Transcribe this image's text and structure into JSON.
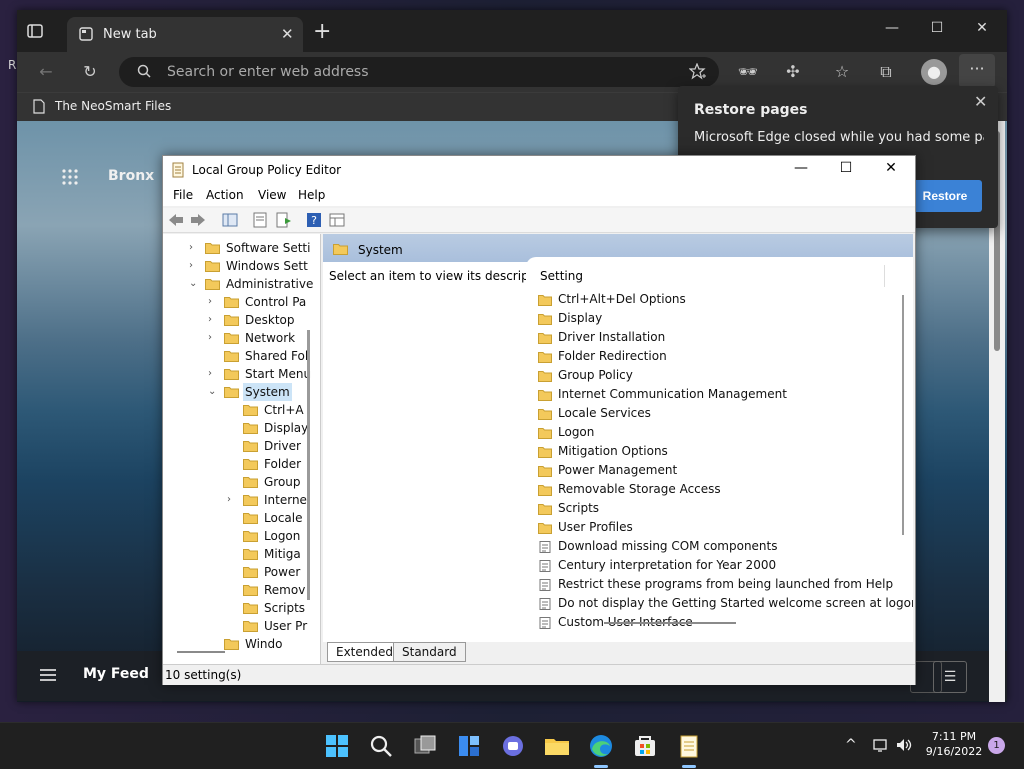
{
  "browser": {
    "tab_title": "New tab",
    "tab_close": "✕",
    "new_tab": "+",
    "minimize": "—",
    "maximize": "☐",
    "close": "✕",
    "address_placeholder": "Search or enter web address",
    "more": "···",
    "bookmark": "The NeoSmart Files"
  },
  "newtab": {
    "location": "Bronx",
    "feed_title": "My Feed"
  },
  "restore": {
    "title": "Restore pages",
    "body": "Microsoft Edge closed while you had some pages open.",
    "button": "Restore",
    "close": "✕"
  },
  "gpe": {
    "title": "Local Group Policy Editor",
    "minimize": "—",
    "maximize": "☐",
    "close": "✕",
    "menu": [
      "File",
      "Action",
      "View",
      "Help"
    ],
    "tree": [
      {
        "label": "Software Setti",
        "level": 1,
        "chevron": "›"
      },
      {
        "label": "Windows Sett",
        "level": 1,
        "chevron": "›"
      },
      {
        "label": "Administrative",
        "level": 1,
        "chevron": "⌄"
      },
      {
        "label": "Control Pa",
        "level": 2,
        "chevron": "›"
      },
      {
        "label": "Desktop",
        "level": 2,
        "chevron": "›"
      },
      {
        "label": "Network",
        "level": 2,
        "chevron": "›"
      },
      {
        "label": "Shared Fol",
        "level": 2,
        "chevron": ""
      },
      {
        "label": "Start Menu",
        "level": 2,
        "chevron": "›"
      },
      {
        "label": "System",
        "level": 2,
        "chevron": "⌄",
        "selected": true
      },
      {
        "label": "Ctrl+A",
        "level": 3,
        "chevron": ""
      },
      {
        "label": "Display",
        "level": 3,
        "chevron": ""
      },
      {
        "label": "Driver",
        "level": 3,
        "chevron": ""
      },
      {
        "label": "Folder",
        "level": 3,
        "chevron": ""
      },
      {
        "label": "Group",
        "level": 3,
        "chevron": ""
      },
      {
        "label": "Interne",
        "level": 3,
        "chevron": "›"
      },
      {
        "label": "Locale",
        "level": 3,
        "chevron": ""
      },
      {
        "label": "Logon",
        "level": 3,
        "chevron": ""
      },
      {
        "label": "Mitiga",
        "level": 3,
        "chevron": ""
      },
      {
        "label": "Power",
        "level": 3,
        "chevron": ""
      },
      {
        "label": "Remov",
        "level": 3,
        "chevron": ""
      },
      {
        "label": "Scripts",
        "level": 3,
        "chevron": ""
      },
      {
        "label": "User Pr",
        "level": 3,
        "chevron": ""
      },
      {
        "label": "Windo",
        "level": 2,
        "chevron": ""
      }
    ],
    "section_title": "System",
    "description": "Select an item to view its description.",
    "column_header": "Setting",
    "settings": [
      {
        "label": "Ctrl+Alt+Del Options",
        "type": "folder"
      },
      {
        "label": "Display",
        "type": "folder"
      },
      {
        "label": "Driver Installation",
        "type": "folder"
      },
      {
        "label": "Folder Redirection",
        "type": "folder"
      },
      {
        "label": "Group Policy",
        "type": "folder"
      },
      {
        "label": "Internet Communication Management",
        "type": "folder"
      },
      {
        "label": "Locale Services",
        "type": "folder"
      },
      {
        "label": "Logon",
        "type": "folder"
      },
      {
        "label": "Mitigation Options",
        "type": "folder"
      },
      {
        "label": "Power Management",
        "type": "folder"
      },
      {
        "label": "Removable Storage Access",
        "type": "folder"
      },
      {
        "label": "Scripts",
        "type": "folder"
      },
      {
        "label": "User Profiles",
        "type": "folder"
      },
      {
        "label": "Download missing COM components",
        "type": "policy"
      },
      {
        "label": "Century interpretation for Year 2000",
        "type": "policy"
      },
      {
        "label": "Restrict these programs from being launched from Help",
        "type": "policy"
      },
      {
        "label": "Do not display the Getting Started welcome screen at logon",
        "type": "policy"
      },
      {
        "label": "Custom User Interface",
        "type": "policy"
      }
    ],
    "view_tabs": [
      "Extended",
      "Standard"
    ],
    "status": "10 setting(s)"
  },
  "taskbar": {
    "time": "7:11 PM",
    "date": "9/16/2022",
    "notifications": "1",
    "tray_chevron": "^"
  },
  "colors": {
    "accent": "#3b82d6",
    "selection": "#cce4f7",
    "folder": "#f3c95b"
  }
}
